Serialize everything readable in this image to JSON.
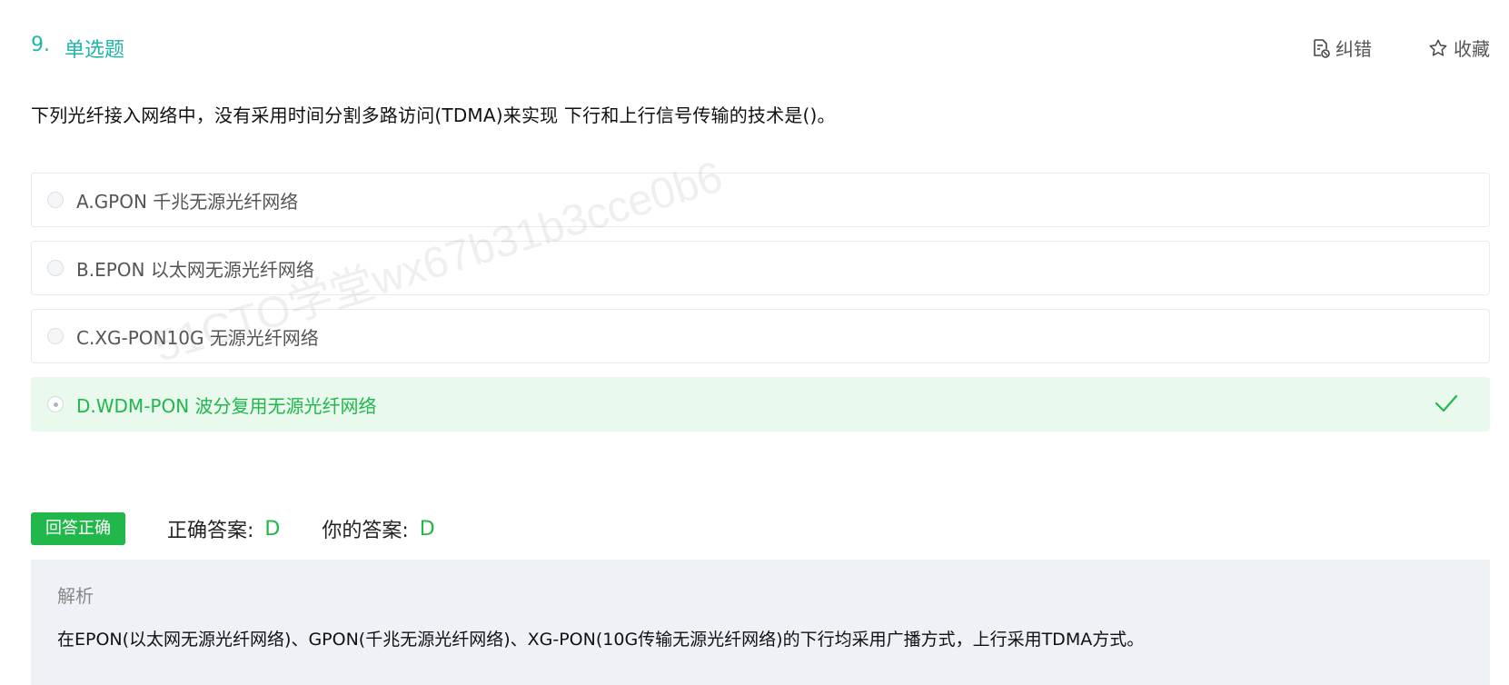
{
  "question": {
    "number": "9.",
    "type": "单选题",
    "stem": "下列光纤接入网络中，没有采用时间分割多路访问(TDMA)来实现 下行和上行信号传输的技术是()。"
  },
  "actions": {
    "report_label": "纠错",
    "favorite_label": "收藏"
  },
  "options": [
    {
      "label": "A.GPON 千兆无源光纤网络",
      "state": "unselected"
    },
    {
      "label": "B.EPON 以太网无源光纤网络",
      "state": "unselected"
    },
    {
      "label": "C.XG-PON10G 无源光纤网络",
      "state": "unselected"
    },
    {
      "label": "D.WDM-PON 波分复用无源光纤网络",
      "state": "selected-correct"
    }
  ],
  "watermark": "51CTO学堂wx67b31b3cce0b6",
  "result": {
    "badge": "回答正确",
    "correct_answer_label": "正确答案:",
    "correct_answer_value": "D",
    "your_answer_label": "你的答案:",
    "your_answer_value": "D"
  },
  "analysis": {
    "title": "解析",
    "body": "在EPON(以太网无源光纤网络)、GPON(千兆无源光纤网络)、XG-PON(10G传输无源光纤网络)的下行均采用广播方式，上行采用TDMA方式。"
  },
  "colors": {
    "accent_teal": "#1fb6a9",
    "correct_green": "#21b74a",
    "correct_bg": "#e9f9ee",
    "analysis_bg": "#eef1f6"
  },
  "icons": {
    "report": "report-document-icon",
    "favorite": "star-outline-icon",
    "correct": "checkmark-icon"
  }
}
